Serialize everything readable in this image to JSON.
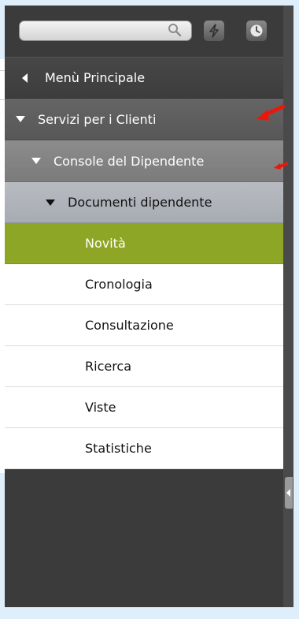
{
  "toolbar": {
    "search_placeholder": "",
    "search_icon": "search-icon",
    "bolt_icon": "lightning-icon",
    "clock_icon": "clock-icon"
  },
  "menu": {
    "main": "Menù Principale",
    "services": "Servizi per i Clienti",
    "console": "Console del Dipendente",
    "documents": "Documenti dipendente",
    "leaves": [
      {
        "label": "Novità",
        "active": true
      },
      {
        "label": "Cronologia",
        "active": false
      },
      {
        "label": "Consultazione",
        "active": false
      },
      {
        "label": "Ricerca",
        "active": false
      },
      {
        "label": "Viste",
        "active": false
      },
      {
        "label": "Statistiche",
        "active": false
      }
    ]
  },
  "colors": {
    "active_item": "#8ea626",
    "annotation_arrow": "#e8180c",
    "sidebar_bg": "#3b3b3b"
  }
}
